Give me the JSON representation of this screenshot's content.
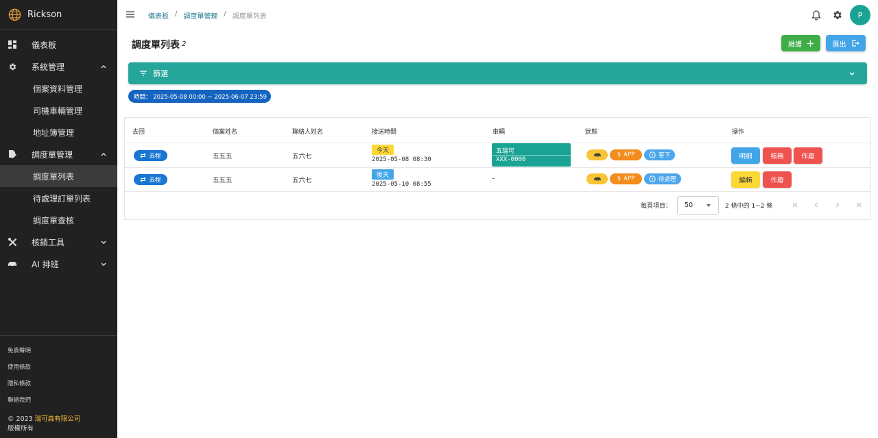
{
  "sidebar": {
    "brand": "Rickson",
    "items": [
      {
        "label": "儀表板",
        "icon": "dashboard-icon"
      },
      {
        "label": "系統管理",
        "icon": "gear-icon"
      },
      {
        "label": "個案資料管理"
      },
      {
        "label": "司機車輛管理"
      },
      {
        "label": "地址簿管理"
      },
      {
        "label": "調度單管理",
        "icon": "document-edit-icon"
      },
      {
        "label": "調度單列表"
      },
      {
        "label": "待處理訂單列表"
      },
      {
        "label": "調度單查核"
      },
      {
        "label": "核銷工具",
        "icon": "tools-icon"
      },
      {
        "label": "AI 排班",
        "icon": "car-icon"
      }
    ],
    "footer_links": [
      "免責聲明",
      "使用條款",
      "隱私條款",
      "聯絡我們"
    ],
    "copyright_prefix": "© 2023 ",
    "company": "瑞可森有限公司",
    "rights": "版權所有"
  },
  "topbar": {
    "breadcrumbs": [
      "儀表板",
      "調度單管理",
      "調度單列表"
    ],
    "avatar_letter": "P"
  },
  "page": {
    "title": "調度單列表",
    "count": "2",
    "maintain_label": "維護",
    "export_label": "匯出"
  },
  "filter": {
    "label": "篩選",
    "time_chip": "時間： 2025-05-08 00:00 ~ 2025-06-07 23:59"
  },
  "table": {
    "columns": [
      "去回",
      "個案姓名",
      "聯絡人姓名",
      "接送時間",
      "車輛",
      "狀態",
      "操作"
    ],
    "rows": [
      {
        "direction": "去程",
        "case_name": "五五五",
        "contact_name": "五六七",
        "day_badge": "今天",
        "datetime": "2025-05-08 08:30",
        "vehicle_name": "五瑞可",
        "vehicle_plate": "XXX-0000",
        "app_label": "APP",
        "status": "客下",
        "actions": [
          "明細",
          "帳務",
          "作廢"
        ]
      },
      {
        "direction": "去程",
        "case_name": "五五五",
        "contact_name": "五六七",
        "day_badge": "後天",
        "datetime": "2025-05-10 08:55",
        "vehicle_empty": "–",
        "app_label": "APP",
        "status": "待處理",
        "actions": [
          "編輯",
          "作廢"
        ]
      }
    ]
  },
  "pagination": {
    "per_page_label": "每頁項目：",
    "per_page_value": "50",
    "range_text": "2 條中的 1~2 條"
  },
  "colors": {
    "sidebar_bg": "#212121",
    "primary_teal": "#26a69a",
    "blue": "#1976d2",
    "green": "#3fae48",
    "red": "#ef5350",
    "yellow": "#fdd835",
    "orange": "#f48c1c"
  }
}
